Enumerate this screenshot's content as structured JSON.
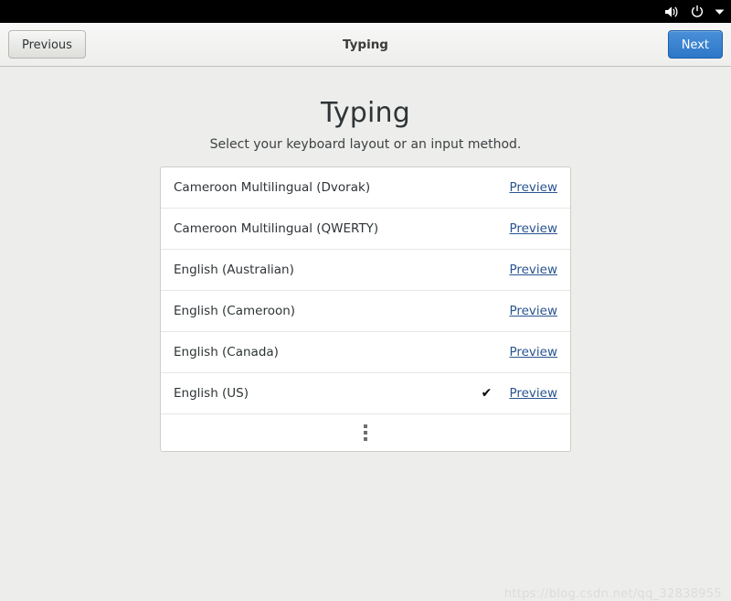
{
  "topbar": {
    "icons": [
      {
        "name": "volume-icon",
        "label": "volume"
      },
      {
        "name": "power-icon",
        "label": "power"
      },
      {
        "name": "chevron-down-icon",
        "label": "system menu"
      }
    ]
  },
  "header": {
    "title": "Typing",
    "previous_label": "Previous",
    "next_label": "Next",
    "next_color": "#3584c8"
  },
  "main": {
    "title": "Typing",
    "subtitle": "Select your keyboard layout or an input method.",
    "preview_label": "Preview",
    "check_glyph": "✔",
    "rows": [
      {
        "label": "Cameroon Multilingual (Dvorak)",
        "selected": false
      },
      {
        "label": "Cameroon Multilingual (QWERTY)",
        "selected": false
      },
      {
        "label": "English (Australian)",
        "selected": false
      },
      {
        "label": "English (Cameroon)",
        "selected": false
      },
      {
        "label": "English (Canada)",
        "selected": false
      },
      {
        "label": "English (US)",
        "selected": true
      }
    ]
  },
  "watermark": {
    "text": "https://blog.csdn.net/qq_32838955"
  }
}
